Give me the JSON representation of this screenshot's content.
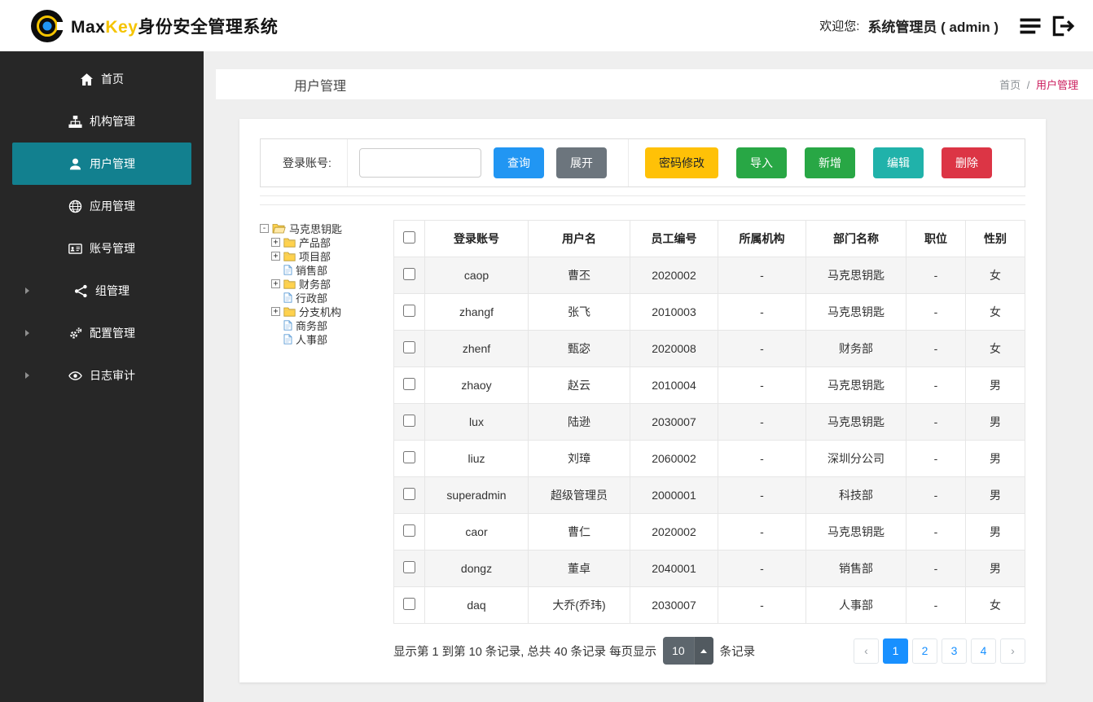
{
  "header": {
    "brand": {
      "max": "Max",
      "key": "Key",
      "suffix": "身份安全管理系统"
    },
    "welcome_label": "欢迎您:",
    "user_name": "系统管理员 ( admin )"
  },
  "sidebar": {
    "items": [
      {
        "id": "home",
        "label": "首页",
        "icon": "home-icon",
        "active": false,
        "chevron": false
      },
      {
        "id": "org",
        "label": "机构管理",
        "icon": "sitemap-icon",
        "active": false,
        "chevron": false
      },
      {
        "id": "user",
        "label": "用户管理",
        "icon": "user-icon",
        "active": true,
        "chevron": false
      },
      {
        "id": "app",
        "label": "应用管理",
        "icon": "globe-icon",
        "active": false,
        "chevron": false
      },
      {
        "id": "account",
        "label": "账号管理",
        "icon": "id-card-icon",
        "active": false,
        "chevron": false
      },
      {
        "id": "group",
        "label": "组管理",
        "icon": "group-icon",
        "active": false,
        "chevron": true
      },
      {
        "id": "config",
        "label": "配置管理",
        "icon": "gears-icon",
        "active": false,
        "chevron": true
      },
      {
        "id": "audit",
        "label": "日志审计",
        "icon": "eye-icon",
        "active": false,
        "chevron": true
      }
    ]
  },
  "page": {
    "title": "用户管理",
    "breadcrumb": {
      "home": "首页",
      "separator": "/",
      "current": "用户管理"
    }
  },
  "toolbar": {
    "search_label": "登录账号:",
    "search_value": "",
    "buttons": {
      "query": "查询",
      "expand": "展开",
      "password": "密码修改",
      "import": "导入",
      "add": "新增",
      "edit": "编辑",
      "delete": "删除"
    }
  },
  "tree": {
    "root": "马克思钥匙",
    "root_expander": "-",
    "nodes": [
      {
        "label": "产品部",
        "type": "folder",
        "expander": "+"
      },
      {
        "label": "项目部",
        "type": "folder",
        "expander": "+"
      },
      {
        "label": "销售部",
        "type": "file",
        "expander": ""
      },
      {
        "label": "财务部",
        "type": "folder",
        "expander": "+"
      },
      {
        "label": "行政部",
        "type": "file",
        "expander": ""
      },
      {
        "label": "分支机构",
        "type": "folder",
        "expander": "+"
      },
      {
        "label": "商务部",
        "type": "file",
        "expander": ""
      },
      {
        "label": "人事部",
        "type": "file",
        "expander": ""
      }
    ]
  },
  "table": {
    "headers": [
      "登录账号",
      "用户名",
      "员工编号",
      "所属机构",
      "部门名称",
      "职位",
      "性别"
    ],
    "rows": [
      [
        "caop",
        "曹丕",
        "2020002",
        "-",
        "马克思钥匙",
        "-",
        "女"
      ],
      [
        "zhangf",
        "张飞",
        "2010003",
        "-",
        "马克思钥匙",
        "-",
        "女"
      ],
      [
        "zhenf",
        "甄宓",
        "2020008",
        "-",
        "财务部",
        "-",
        "女"
      ],
      [
        "zhaoy",
        "赵云",
        "2010004",
        "-",
        "马克思钥匙",
        "-",
        "男"
      ],
      [
        "lux",
        "陆逊",
        "2030007",
        "-",
        "马克思钥匙",
        "-",
        "男"
      ],
      [
        "liuz",
        "刘璋",
        "2060002",
        "-",
        "深圳分公司",
        "-",
        "男"
      ],
      [
        "superadmin",
        "超级管理员",
        "2000001",
        "-",
        "科技部",
        "-",
        "男"
      ],
      [
        "caor",
        "曹仁",
        "2020002",
        "-",
        "马克思钥匙",
        "-",
        "男"
      ],
      [
        "dongz",
        "董卓",
        "2040001",
        "-",
        "销售部",
        "-",
        "男"
      ],
      [
        "daq",
        "大乔(乔玮)",
        "2030007",
        "-",
        "人事部",
        "-",
        "女"
      ]
    ]
  },
  "pagination": {
    "summary_prefix": "显示第 1 到第 10 条记录, 总共 40 条记录  每页显示",
    "page_size": "10",
    "summary_suffix": "条记录",
    "prev": "‹",
    "next": "›",
    "pages": [
      "1",
      "2",
      "3",
      "4"
    ],
    "active_page": "1"
  },
  "colors": {
    "sidebar_bg": "#272727",
    "active_item_teal": "#12808f",
    "brand_gold": "#f5c400",
    "primary_blue": "#2196f3",
    "success_green": "#28a745",
    "warning_amber": "#ffc107",
    "info_teal": "#20b2aa",
    "danger_red": "#dc3545",
    "gray_button": "#6c757d",
    "breadcrumb_pink": "#cc1f5e",
    "pagination_blue": "#1890ff"
  }
}
